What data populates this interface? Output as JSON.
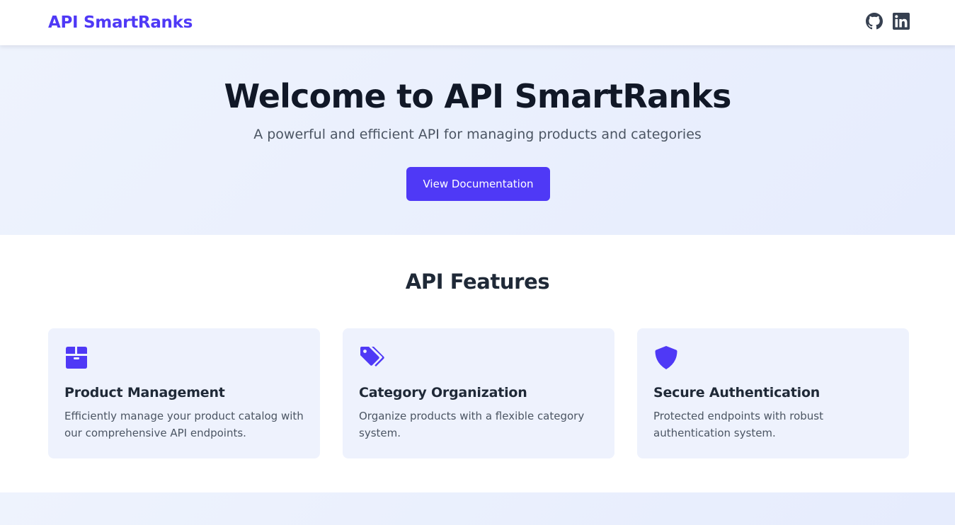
{
  "navbar": {
    "brand": "API SmartRanks",
    "icons": [
      "github-icon",
      "linkedin-icon"
    ]
  },
  "hero": {
    "title": "Welcome to API SmartRanks",
    "subtitle": "A powerful and efficient API for managing products and categories",
    "button_label": "View Documentation"
  },
  "features": {
    "heading": "API Features",
    "cards": [
      {
        "icon": "box-icon",
        "title": "Product Management",
        "description": "Efficiently manage your product catalog with our comprehensive API endpoints."
      },
      {
        "icon": "tags-icon",
        "title": "Category Organization",
        "description": "Organize products with a flexible category system."
      },
      {
        "icon": "shield-icon",
        "title": "Secure Authentication",
        "description": "Protected endpoints with robust authentication system."
      }
    ]
  },
  "colors": {
    "accent": "#4f39f6",
    "hero_bg": "#eef3fd",
    "card_bg": "#eef2fd",
    "heading": "#111827",
    "body_text": "#4b5563"
  }
}
